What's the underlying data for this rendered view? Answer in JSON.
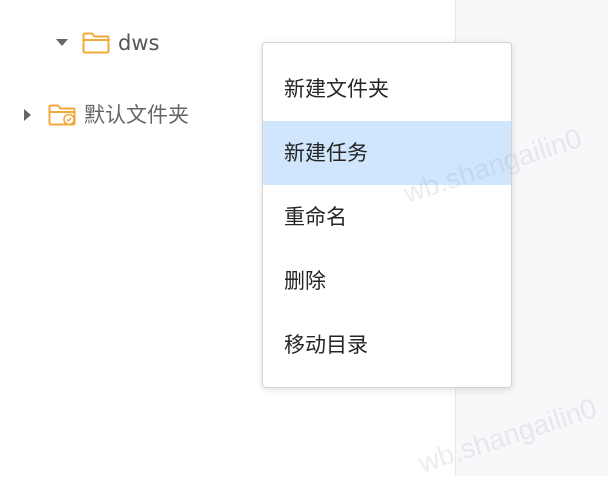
{
  "tree": {
    "nodes": [
      {
        "label": "dws",
        "expanded": true,
        "icon": "folder-open-icon",
        "color": "#f0a93a"
      },
      {
        "label": "默认文件夹",
        "expanded": false,
        "icon": "folder-default-icon",
        "color": "#f0a93a"
      }
    ]
  },
  "context_menu": {
    "items": [
      {
        "label": "新建文件夹",
        "highlighted": false
      },
      {
        "label": "新建任务",
        "highlighted": true
      },
      {
        "label": "重命名",
        "highlighted": false
      },
      {
        "label": "删除",
        "highlighted": false
      },
      {
        "label": "移动目录",
        "highlighted": false
      }
    ],
    "highlight_color": "#cfe6fd"
  },
  "watermark": {
    "text_1": "wb.shangailin0",
    "text_2": "wb.shangailin0"
  }
}
